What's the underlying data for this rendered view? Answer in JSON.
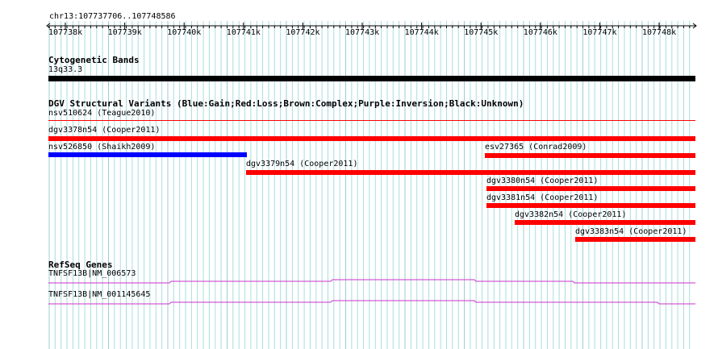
{
  "ruler": {
    "location": "chr13:107737706..107748586",
    "ticks": [
      "107738k",
      "107739k",
      "107740k",
      "107741k",
      "107742k",
      "107743k",
      "107744k",
      "107745k",
      "107746k",
      "107747k",
      "107748k"
    ]
  },
  "cytoband": {
    "title": "Cytogenetic Bands",
    "band": "13q33.3",
    "color": "#000000"
  },
  "dgv": {
    "title": "DGV Structural Variants (Blue:Gain;Red:Loss;Brown:Complex;Purple:Inversion;Black:Unknown)",
    "features": [
      {
        "label": "nsv510624 (Teague2010)",
        "color": "#ff0000",
        "thin": true
      },
      {
        "label": "dgv3378n54 (Cooper2011)",
        "color": "#ff0000"
      },
      {
        "label": "nsv526850 (Shaikh2009)",
        "color": "#0000ff"
      },
      {
        "label": "esv27365 (Conrad2009)",
        "color": "#ff0000"
      },
      {
        "label": "dgv3379n54 (Cooper2011)",
        "color": "#ff0000"
      },
      {
        "label": "dgv3380n54 (Cooper2011)",
        "color": "#ff0000"
      },
      {
        "label": "dgv3381n54 (Cooper2011)",
        "color": "#ff0000"
      },
      {
        "label": "dgv3382n54 (Cooper2011)",
        "color": "#ff0000"
      },
      {
        "label": "dgv3383n54 (Cooper2011)",
        "color": "#ff0000"
      }
    ]
  },
  "refseq": {
    "title": "RefSeq Genes",
    "genes": [
      {
        "label": "TNFSF13B|NM_006573",
        "color": "#cc33cc"
      },
      {
        "label": "TNFSF13B|NM_001145645",
        "color": "#cc33cc"
      }
    ]
  },
  "colors": {
    "grid": "#aadddd",
    "ruler": "#000000"
  }
}
